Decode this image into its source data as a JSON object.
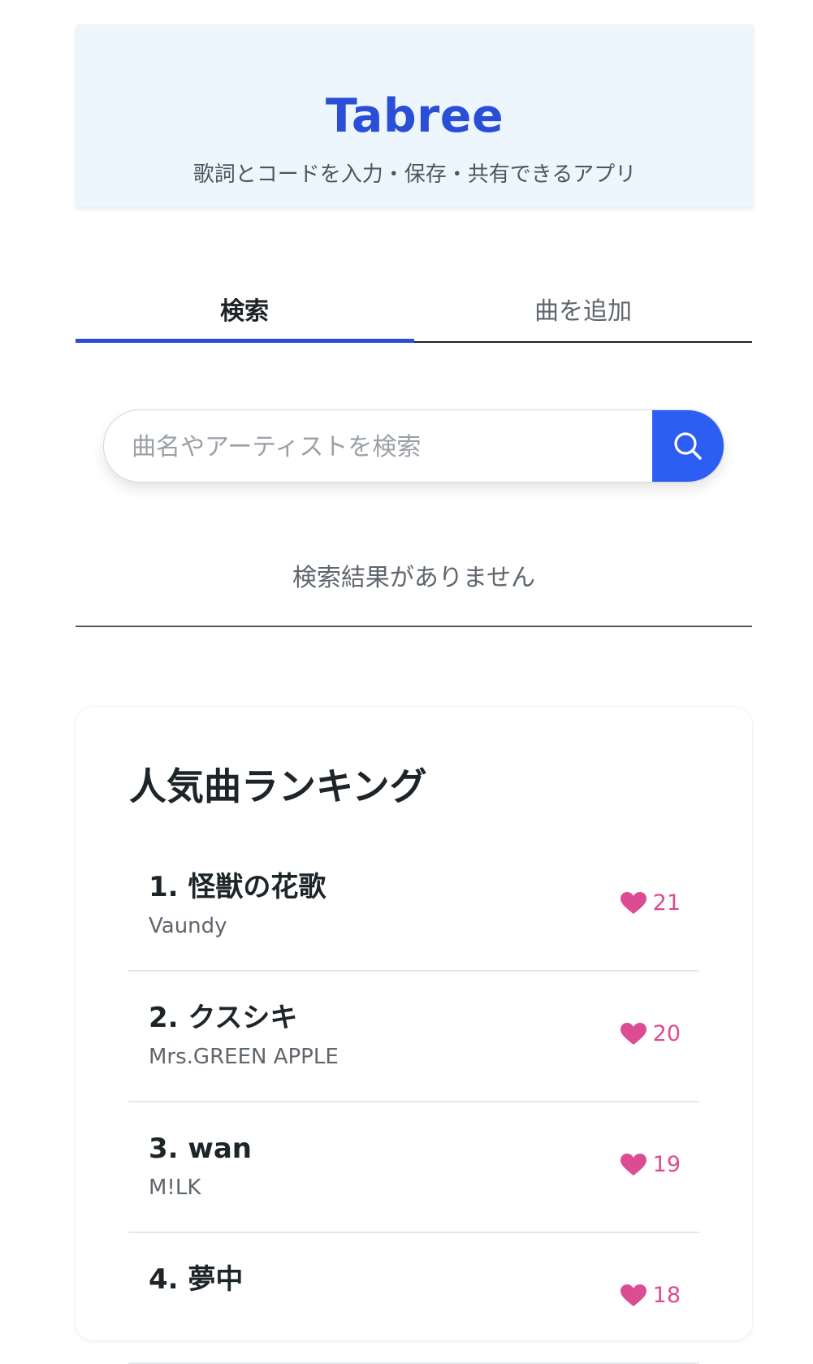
{
  "header": {
    "title": "Tabree",
    "subtitle": "歌詞とコードを入力・保存・共有できるアプリ"
  },
  "tabs": [
    {
      "label": "検索",
      "active": true
    },
    {
      "label": "曲を追加",
      "active": false
    }
  ],
  "search": {
    "placeholder": "曲名やアーティストを検索",
    "value": "",
    "button_icon": "search-icon"
  },
  "results": {
    "empty_message": "検索結果がありません"
  },
  "ranking": {
    "title": "人気曲ランキング",
    "items": [
      {
        "title": "1. 怪獣の花歌",
        "artist": "Vaundy",
        "likes": "21"
      },
      {
        "title": "2. クスシキ",
        "artist": "Mrs.GREEN APPLE",
        "likes": "20"
      },
      {
        "title": "3. wan",
        "artist": "M!LK",
        "likes": "19"
      },
      {
        "title": "4. 夢中",
        "artist": "",
        "likes": "18"
      }
    ],
    "like_icon": "heart-icon"
  },
  "colors": {
    "brand": "#2a4fd6",
    "search_button": "#2d5ef3",
    "header_bg": "#edf5fd",
    "like": "#db4c92"
  }
}
